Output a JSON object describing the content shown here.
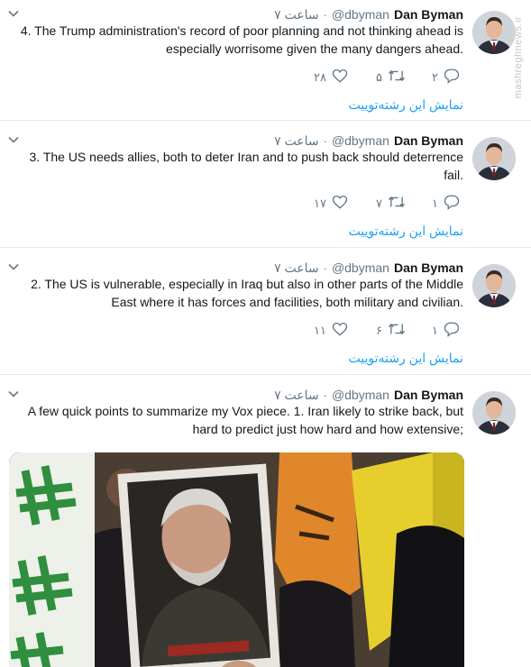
{
  "tweets": [
    {
      "name": "Dan Byman",
      "handle": "@dbyman",
      "dot": "·",
      "time": "۷ ساعت",
      "text": "4. The Trump administration's record of poor planning and not thinking ahead is especially worrisome given the many dangers ahead.",
      "replies": "۲",
      "retweets": "۵",
      "likes": "۲۸",
      "show_thread": "نمایش این رشته‌توییت"
    },
    {
      "name": "Dan Byman",
      "handle": "@dbyman",
      "dot": "·",
      "time": "۷ ساعت",
      "text": "3. The US needs allies, both to deter Iran and to push back should deterrence fail.",
      "replies": "۱",
      "retweets": "۷",
      "likes": "۱۷",
      "show_thread": "نمایش این رشته‌توییت"
    },
    {
      "name": "Dan Byman",
      "handle": "@dbyman",
      "dot": "·",
      "time": "۷ ساعت",
      "text": "2. The US is vulnerable, especially in Iraq but also in other parts of the Middle East where it has forces and facilities, both military and civilian.",
      "replies": "۱",
      "retweets": "۶",
      "likes": "۱۱",
      "show_thread": "نمایش این رشته‌توییت"
    },
    {
      "name": "Dan Byman",
      "handle": "@dbyman",
      "dot": "·",
      "time": "۷ ساعت",
      "text": "A few quick points to summarize my Vox piece. 1. Iran likely to strike back, but hard to predict just how hard and how extensive;"
    }
  ],
  "watermark": "mashreghnews.ir",
  "colors": {
    "link": "#1da1f2",
    "muted": "#657786",
    "text": "#14171a",
    "divider": "#e6ecf0"
  },
  "icons": [
    "reply-icon",
    "retweet-icon",
    "like-icon",
    "chevron-down-icon"
  ]
}
